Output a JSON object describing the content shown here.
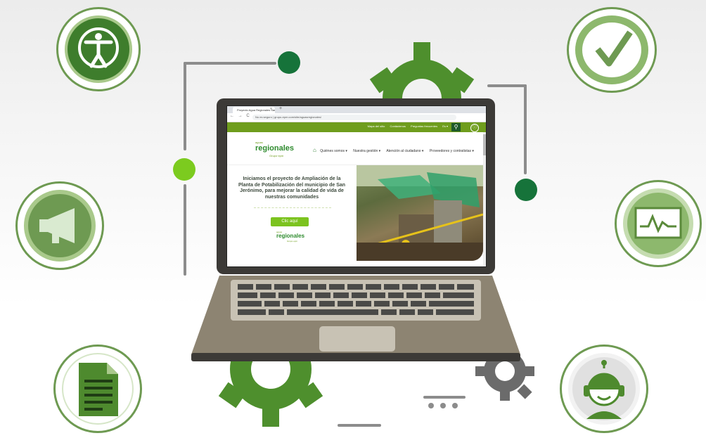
{
  "browser": {
    "tab_title": "Proyecto Agua Regionales San...",
    "tab_close": "×",
    "new_tab": "+",
    "nav_arrows": "← → C",
    "url": "No es seguro | grupo-epm.com/site/aguasregionales/"
  },
  "site": {
    "top_links": [
      "Mapa del sitio",
      "Contáctenos",
      "Preguntas frecuentes",
      "Es ▾"
    ],
    "search_icon": "search-icon",
    "search_glyph": "⚲",
    "a11y_glyph": "ⓘ",
    "logo_small": "aguas",
    "logo_main": "regionales",
    "logo_sub": "Grupo·epm",
    "home_glyph": "⌂",
    "menu": [
      "Quiénes somos ▾",
      "Nuestra gestión ▾",
      "Atención al ciudadano ▾",
      "Proveedores y contratistas ▾"
    ],
    "hero_title": "Iniciamos el proyecto de Ampliación de la Planta de Potabilización del municipio de San Jerónimo, para mejorar la calidad de vida de nuestras comunidades",
    "cta_label": "Clic aquí",
    "hero_logo_small": "aguas",
    "hero_logo_main": "regionales",
    "hero_logo_sub": "Grupo·epm"
  },
  "decor": {
    "icons": [
      "accessibility-icon",
      "checkmark-icon",
      "megaphone-icon",
      "monitor-chart-icon",
      "document-icon",
      "support-agent-icon",
      "gear-icon"
    ],
    "colors": {
      "green_dark": "#1e6b36",
      "green_mid": "#4e8a2e",
      "green_light": "#7cc31f",
      "gray": "#8c8c8c"
    }
  }
}
